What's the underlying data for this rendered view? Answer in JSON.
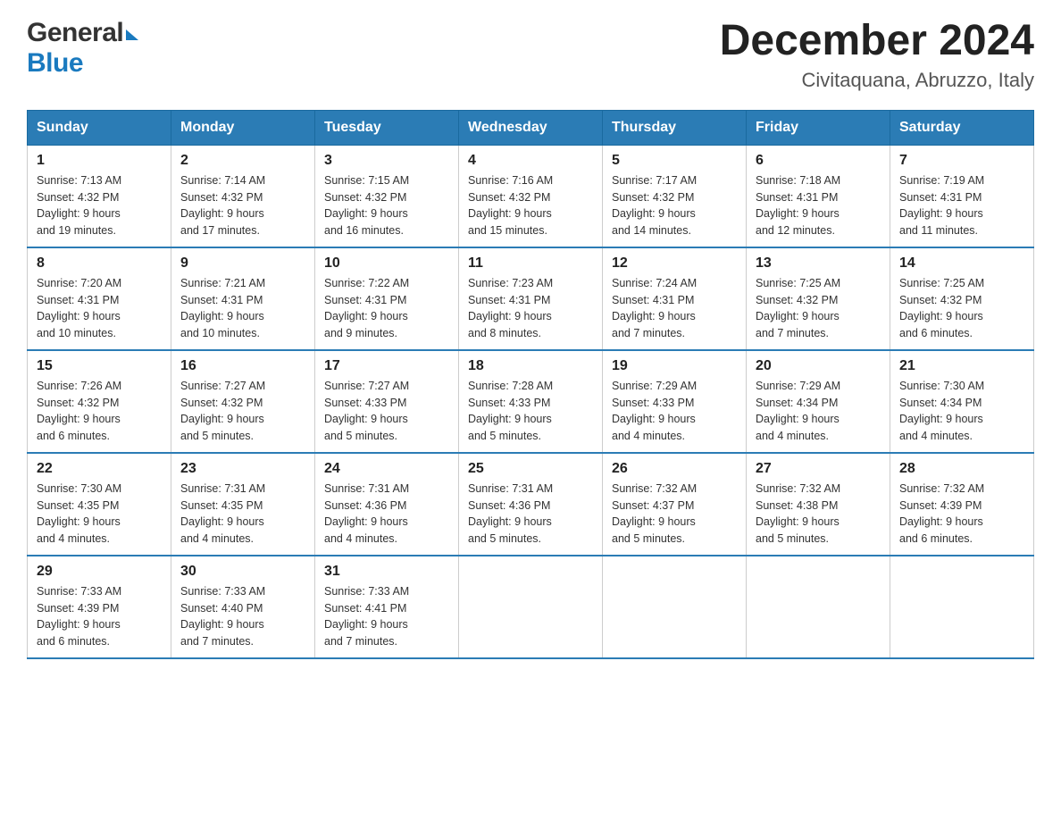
{
  "header": {
    "logo": {
      "general": "General",
      "blue": "Blue"
    },
    "title": "December 2024",
    "location": "Civitaquana, Abruzzo, Italy"
  },
  "weekdays": [
    "Sunday",
    "Monday",
    "Tuesday",
    "Wednesday",
    "Thursday",
    "Friday",
    "Saturday"
  ],
  "weeks": [
    [
      {
        "day": "1",
        "sunrise": "7:13 AM",
        "sunset": "4:32 PM",
        "daylight": "9 hours and 19 minutes."
      },
      {
        "day": "2",
        "sunrise": "7:14 AM",
        "sunset": "4:32 PM",
        "daylight": "9 hours and 17 minutes."
      },
      {
        "day": "3",
        "sunrise": "7:15 AM",
        "sunset": "4:32 PM",
        "daylight": "9 hours and 16 minutes."
      },
      {
        "day": "4",
        "sunrise": "7:16 AM",
        "sunset": "4:32 PM",
        "daylight": "9 hours and 15 minutes."
      },
      {
        "day": "5",
        "sunrise": "7:17 AM",
        "sunset": "4:32 PM",
        "daylight": "9 hours and 14 minutes."
      },
      {
        "day": "6",
        "sunrise": "7:18 AM",
        "sunset": "4:31 PM",
        "daylight": "9 hours and 12 minutes."
      },
      {
        "day": "7",
        "sunrise": "7:19 AM",
        "sunset": "4:31 PM",
        "daylight": "9 hours and 11 minutes."
      }
    ],
    [
      {
        "day": "8",
        "sunrise": "7:20 AM",
        "sunset": "4:31 PM",
        "daylight": "9 hours and 10 minutes."
      },
      {
        "day": "9",
        "sunrise": "7:21 AM",
        "sunset": "4:31 PM",
        "daylight": "9 hours and 10 minutes."
      },
      {
        "day": "10",
        "sunrise": "7:22 AM",
        "sunset": "4:31 PM",
        "daylight": "9 hours and 9 minutes."
      },
      {
        "day": "11",
        "sunrise": "7:23 AM",
        "sunset": "4:31 PM",
        "daylight": "9 hours and 8 minutes."
      },
      {
        "day": "12",
        "sunrise": "7:24 AM",
        "sunset": "4:31 PM",
        "daylight": "9 hours and 7 minutes."
      },
      {
        "day": "13",
        "sunrise": "7:25 AM",
        "sunset": "4:32 PM",
        "daylight": "9 hours and 7 minutes."
      },
      {
        "day": "14",
        "sunrise": "7:25 AM",
        "sunset": "4:32 PM",
        "daylight": "9 hours and 6 minutes."
      }
    ],
    [
      {
        "day": "15",
        "sunrise": "7:26 AM",
        "sunset": "4:32 PM",
        "daylight": "9 hours and 6 minutes."
      },
      {
        "day": "16",
        "sunrise": "7:27 AM",
        "sunset": "4:32 PM",
        "daylight": "9 hours and 5 minutes."
      },
      {
        "day": "17",
        "sunrise": "7:27 AM",
        "sunset": "4:33 PM",
        "daylight": "9 hours and 5 minutes."
      },
      {
        "day": "18",
        "sunrise": "7:28 AM",
        "sunset": "4:33 PM",
        "daylight": "9 hours and 5 minutes."
      },
      {
        "day": "19",
        "sunrise": "7:29 AM",
        "sunset": "4:33 PM",
        "daylight": "9 hours and 4 minutes."
      },
      {
        "day": "20",
        "sunrise": "7:29 AM",
        "sunset": "4:34 PM",
        "daylight": "9 hours and 4 minutes."
      },
      {
        "day": "21",
        "sunrise": "7:30 AM",
        "sunset": "4:34 PM",
        "daylight": "9 hours and 4 minutes."
      }
    ],
    [
      {
        "day": "22",
        "sunrise": "7:30 AM",
        "sunset": "4:35 PM",
        "daylight": "9 hours and 4 minutes."
      },
      {
        "day": "23",
        "sunrise": "7:31 AM",
        "sunset": "4:35 PM",
        "daylight": "9 hours and 4 minutes."
      },
      {
        "day": "24",
        "sunrise": "7:31 AM",
        "sunset": "4:36 PM",
        "daylight": "9 hours and 4 minutes."
      },
      {
        "day": "25",
        "sunrise": "7:31 AM",
        "sunset": "4:36 PM",
        "daylight": "9 hours and 5 minutes."
      },
      {
        "day": "26",
        "sunrise": "7:32 AM",
        "sunset": "4:37 PM",
        "daylight": "9 hours and 5 minutes."
      },
      {
        "day": "27",
        "sunrise": "7:32 AM",
        "sunset": "4:38 PM",
        "daylight": "9 hours and 5 minutes."
      },
      {
        "day": "28",
        "sunrise": "7:32 AM",
        "sunset": "4:39 PM",
        "daylight": "9 hours and 6 minutes."
      }
    ],
    [
      {
        "day": "29",
        "sunrise": "7:33 AM",
        "sunset": "4:39 PM",
        "daylight": "9 hours and 6 minutes."
      },
      {
        "day": "30",
        "sunrise": "7:33 AM",
        "sunset": "4:40 PM",
        "daylight": "9 hours and 7 minutes."
      },
      {
        "day": "31",
        "sunrise": "7:33 AM",
        "sunset": "4:41 PM",
        "daylight": "9 hours and 7 minutes."
      },
      null,
      null,
      null,
      null
    ]
  ],
  "labels": {
    "sunrise": "Sunrise:",
    "sunset": "Sunset:",
    "daylight": "Daylight:"
  }
}
